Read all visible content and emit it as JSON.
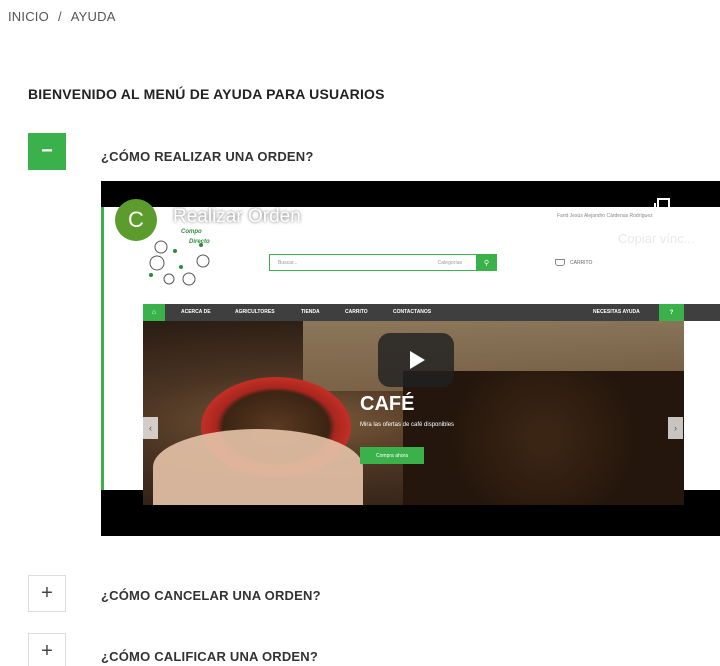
{
  "breadcrumb": {
    "home": "INICIO",
    "separator": "/",
    "current": "AYUDA"
  },
  "help": {
    "title": "BIENVENIDO AL MENÚ DE AYUDA PARA USUARIOS"
  },
  "faq": [
    {
      "toggle": "−",
      "question": "¿CÓMO REALIZAR UNA ORDEN?",
      "expanded": true
    },
    {
      "toggle": "+",
      "question": "¿CÓMO CANCELAR UNA ORDEN?",
      "expanded": false
    },
    {
      "toggle": "+",
      "question": "¿CÓMO CALIFICAR UNA ORDEN?",
      "expanded": false
    }
  ],
  "video": {
    "channel_initial": "C",
    "title": "Realizar Orden",
    "copy_link": "Copiar vínc...",
    "site": {
      "logo_line1": "Compo",
      "logo_line2": "Directo",
      "search_placeholder": "Buscar...",
      "search_category": "Categorías",
      "cart": "CARRITO",
      "nav": [
        "ACERCA DE",
        "AGRICULTORES",
        "TIENDA",
        "CARRITO",
        "CONTACTANOS"
      ],
      "nav_help": "NECESITAS AYUDA",
      "nav_help_icon": "?",
      "hero_title": "CAFÉ",
      "hero_subtitle": "Mira las ofertas de café disponibles",
      "hero_button": "Compra ahora"
    }
  },
  "colors": {
    "accent": "#3ab14b",
    "nav_dark": "#3f3f3f"
  }
}
